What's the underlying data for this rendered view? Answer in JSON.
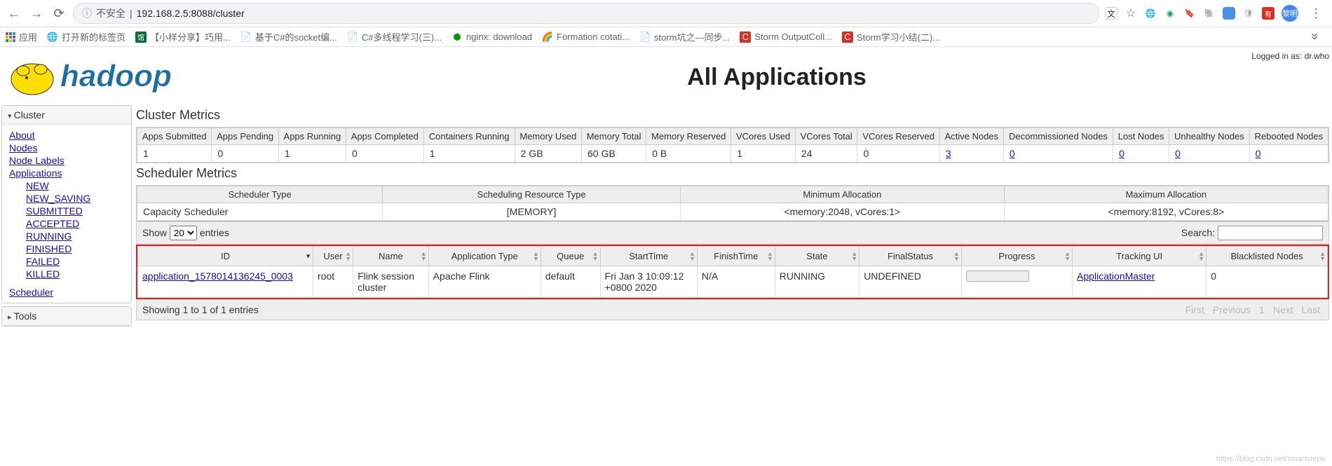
{
  "browser": {
    "insecure_label": "不安全",
    "url": "192.168.2.5:8088/cluster",
    "avatar_label": "黎明"
  },
  "bookmarks": {
    "apps_label": "应用",
    "items": [
      {
        "icon": "globe",
        "label": "打开新的标签页"
      },
      {
        "icon": "green",
        "label": "【小样分享】巧用..."
      },
      {
        "icon": "script",
        "label": "基于C#的socket编..."
      },
      {
        "icon": "script",
        "label": "C#多线程学习(三)..."
      },
      {
        "icon": "nginx",
        "label": "nginx: download"
      },
      {
        "icon": "cloud",
        "label": "Formation cotati..."
      },
      {
        "icon": "script",
        "label": "storm坑之---同步..."
      },
      {
        "icon": "red-c",
        "label": "Storm OutputColl..."
      },
      {
        "icon": "red-c",
        "label": "Storm学习小结(二)..."
      }
    ]
  },
  "header": {
    "logged_in": "Logged in as: dr.who",
    "title": "All Applications"
  },
  "sidebar": {
    "cluster": {
      "title": "Cluster",
      "about": "About",
      "nodes": "Nodes",
      "node_labels": "Node Labels",
      "applications": "Applications",
      "states": [
        "NEW",
        "NEW_SAVING",
        "SUBMITTED",
        "ACCEPTED",
        "RUNNING",
        "FINISHED",
        "FAILED",
        "KILLED"
      ],
      "scheduler": "Scheduler"
    },
    "tools": "Tools"
  },
  "cluster_metrics": {
    "title": "Cluster Metrics",
    "headers": [
      "Apps Submitted",
      "Apps Pending",
      "Apps Running",
      "Apps Completed",
      "Containers Running",
      "Memory Used",
      "Memory Total",
      "Memory Reserved",
      "VCores Used",
      "VCores Total",
      "VCores Reserved",
      "Active Nodes",
      "Decommissioned Nodes",
      "Lost Nodes",
      "Unhealthy Nodes",
      "Rebooted Nodes"
    ],
    "values": [
      "1",
      "0",
      "1",
      "0",
      "1",
      "2 GB",
      "60 GB",
      "0 B",
      "1",
      "24",
      "0",
      "3",
      "0",
      "0",
      "0",
      "0"
    ]
  },
  "scheduler_metrics": {
    "title": "Scheduler Metrics",
    "headers": [
      "Scheduler Type",
      "Scheduling Resource Type",
      "Minimum Allocation",
      "Maximum Allocation"
    ],
    "values": [
      "Capacity Scheduler",
      "[MEMORY]",
      "<memory:2048, vCores:1>",
      "<memory:8192, vCores:8>"
    ]
  },
  "dt": {
    "show_label": "Show",
    "entries_label": "entries",
    "page_size": "20",
    "search_label": "Search:",
    "info": "Showing 1 to 1 of 1 entries",
    "first": "First",
    "prev": "Previous",
    "page": "1",
    "next": "Next",
    "last": "Last"
  },
  "apps_table": {
    "headers": [
      "ID",
      "User",
      "Name",
      "Application Type",
      "Queue",
      "StartTime",
      "FinishTime",
      "State",
      "FinalStatus",
      "Progress",
      "Tracking UI",
      "Blacklisted Nodes"
    ],
    "row": {
      "id": "application_1578014136245_0003",
      "user": "root",
      "name": "Flink session cluster",
      "app_type": "Apache Flink",
      "queue": "default",
      "start_time": "Fri Jan 3 10:09:12 +0800 2020",
      "finish_time": "N/A",
      "state": "RUNNING",
      "final_status": "UNDEFINED",
      "tracking_ui": "ApplicationMaster",
      "blacklisted": "0"
    }
  }
}
